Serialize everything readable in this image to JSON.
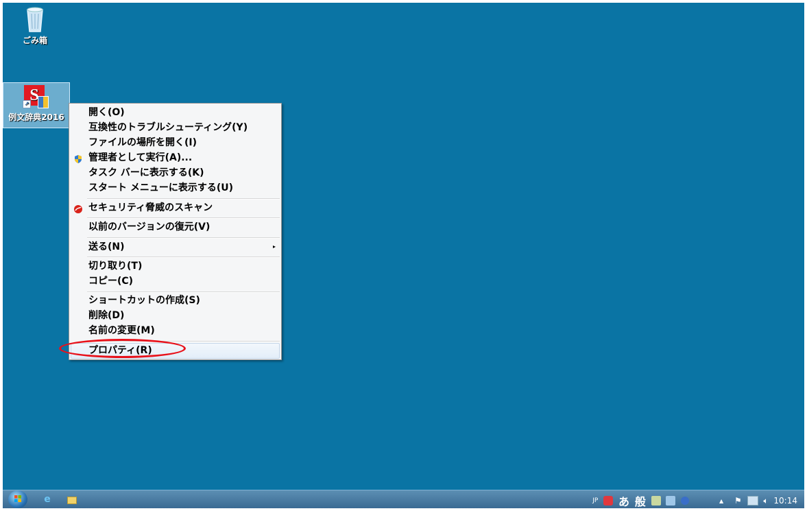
{
  "desktop": {
    "icons": [
      {
        "label": "ごみ箱"
      },
      {
        "label": "例文辞典2016"
      }
    ]
  },
  "context_menu": {
    "items": [
      {
        "label": "開く(O)"
      },
      {
        "label": "互換性のトラブルシューティング(Y)"
      },
      {
        "label": "ファイルの場所を開く(I)"
      },
      {
        "label": "管理者として実行(A)..."
      },
      {
        "label": "タスク バーに表示する(K)"
      },
      {
        "label": "スタート メニューに表示する(U)"
      },
      {
        "label": "セキュリティ脅威のスキャン"
      },
      {
        "label": "以前のバージョンの復元(V)"
      },
      {
        "label": "送る(N)"
      },
      {
        "label": "切り取り(T)"
      },
      {
        "label": "コピー(C)"
      },
      {
        "label": "ショートカットの作成(S)"
      },
      {
        "label": "削除(D)"
      },
      {
        "label": "名前の変更(M)"
      },
      {
        "label": "プロパティ(R)"
      }
    ],
    "highlighted_item": "プロパティ(R)",
    "annotation_color": "#e8121b"
  },
  "taskbar": {
    "tray": {
      "lang": "JP",
      "ime_mode": "あ",
      "ime_style": "般",
      "clock": "10:14"
    }
  },
  "colors": {
    "desktop_bg": "#0a74a4",
    "menu_bg": "#f5f6f7"
  }
}
